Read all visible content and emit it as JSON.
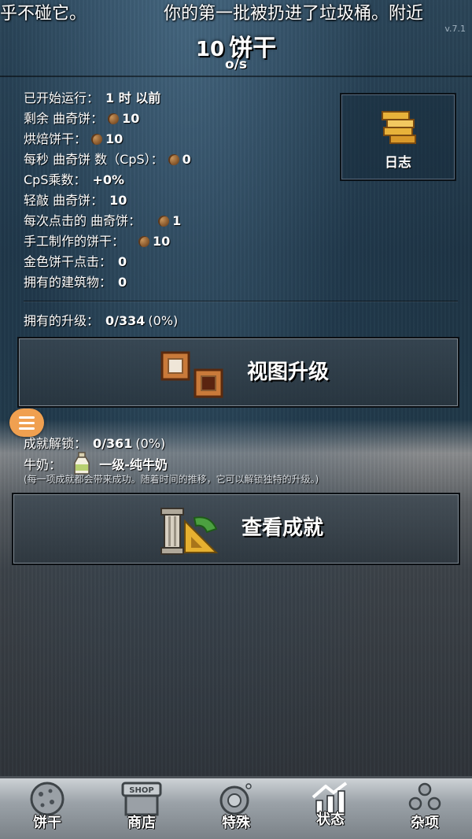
{
  "ticker": {
    "left_text": "乎不碰它。",
    "right_text": "你的第一批被扔进了垃圾桶。附近"
  },
  "version": "v.7.1",
  "header": {
    "cookie_count": "10",
    "cookie_unit": "饼干",
    "cps": "o/s"
  },
  "stats": [
    {
      "label": "已开始运行：",
      "value": "1 时 以前",
      "cookie": false
    },
    {
      "label": "剩余 曲奇饼：",
      "value": "10",
      "cookie": true
    },
    {
      "label": "烘焙饼干：",
      "value": "10",
      "cookie": true
    },
    {
      "label": "每秒 曲奇饼 数（CpS）：",
      "value": "0",
      "cookie": true
    },
    {
      "label": "CpS乘数：",
      "value": "+0%",
      "cookie": false
    },
    {
      "label": "轻敲 曲奇饼：",
      "value": "10",
      "cookie": false
    },
    {
      "label": "每次点击的 曲奇饼：",
      "value": "1",
      "cookie": true
    },
    {
      "label": "手工制作的饼干：",
      "value": "10",
      "cookie": true
    },
    {
      "label": "金色饼干点击：",
      "value": "0",
      "cookie": false
    },
    {
      "label": "拥有的建筑物：",
      "value": "0",
      "cookie": false
    }
  ],
  "log_button": {
    "label": "日志"
  },
  "upgrades": {
    "label": "拥有的升级：",
    "value": "0/334",
    "percent": "(0%)",
    "button_label": "视图升级"
  },
  "achievements": {
    "label": "成就解锁：",
    "value": "0/361",
    "percent": "(0%)",
    "milk_label": "牛奶：",
    "milk_value": "一级-纯牛奶",
    "note": "(每一项成就都会带来成功。随着时间的推移，它可以解锁独特的升级。)",
    "button_label": "查看成就"
  },
  "nav": [
    {
      "label": "饼干",
      "icon": "cookie-icon"
    },
    {
      "label": "商店",
      "icon": "shop-icon",
      "icon_text": "SHOP"
    },
    {
      "label": "特殊",
      "icon": "special-icon"
    },
    {
      "label": "状态",
      "icon": "stats-icon"
    },
    {
      "label": "杂项",
      "icon": "misc-icon"
    }
  ],
  "colors": {
    "menu_fab": "#f0a050",
    "gold": "#e6b030"
  }
}
